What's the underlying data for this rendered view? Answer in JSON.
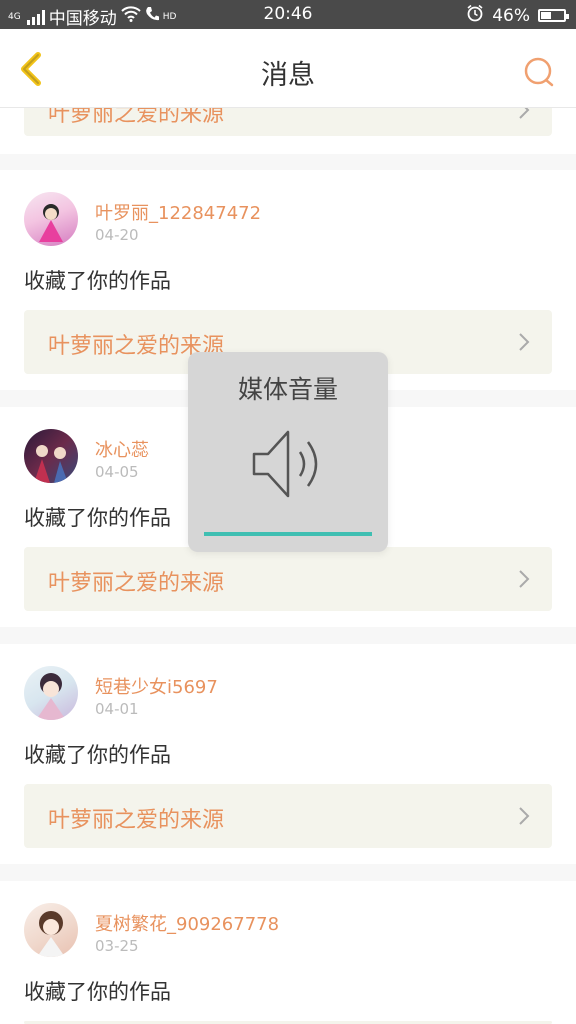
{
  "status": {
    "carrier": "中国移动",
    "network": "4G",
    "hd": "HD",
    "time": "20:46",
    "battery": "46%",
    "battery_level": 0.46
  },
  "header": {
    "title": "消息"
  },
  "partial_top": {
    "work_title": "叶萝丽之爱的来源"
  },
  "messages": [
    {
      "username": "叶罗丽_122847472",
      "date": "04-20",
      "action": "收藏了你的作品",
      "work_title": "叶萝丽之爱的来源"
    },
    {
      "username": "冰心蕊",
      "date": "04-05",
      "action": "收藏了你的作品",
      "work_title": "叶萝丽之爱的来源"
    },
    {
      "username": "短巷少女i5697",
      "date": "04-01",
      "action": "收藏了你的作品",
      "work_title": "叶萝丽之爱的来源"
    },
    {
      "username": "夏树繁花_909267778",
      "date": "03-25",
      "action": "收藏了你的作品",
      "work_title": ""
    }
  ],
  "volume_overlay": {
    "title": "媒体音量",
    "level": 1.0
  },
  "colors": {
    "accent": "#e8925e",
    "work_bg": "#f4f4ec",
    "volume_fill": "#3fbfb2"
  }
}
